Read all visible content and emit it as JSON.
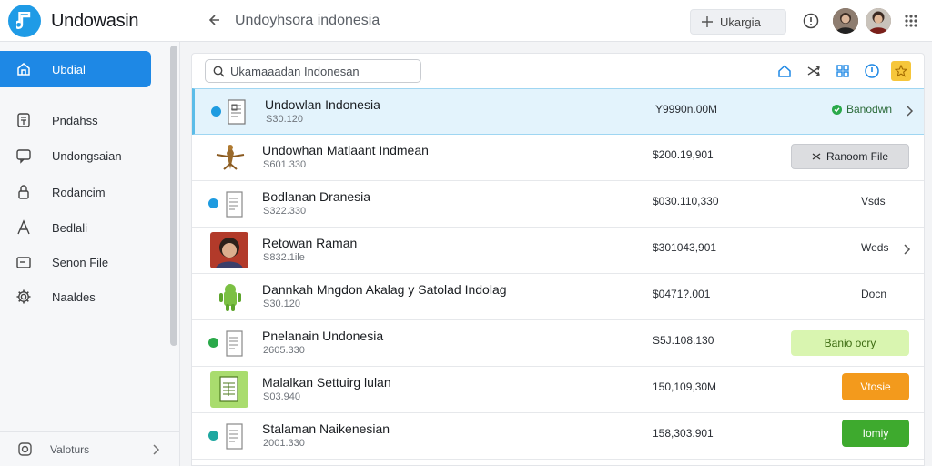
{
  "app": {
    "title": "Undowasin",
    "window_title": "Undoyhsora indonesia"
  },
  "header": {
    "search_chip_label": "Ukargia",
    "icons": [
      "info-icon",
      "avatar-1",
      "avatar-2",
      "more-grid-icon"
    ]
  },
  "sidebar": {
    "items": [
      {
        "label": "Ubdial",
        "icon": "home-icon",
        "active": true
      },
      {
        "label": "Pndahss",
        "icon": "document-icon",
        "active": false
      },
      {
        "label": "Undongsaian",
        "icon": "chat-icon",
        "active": false
      },
      {
        "label": "Rodancim",
        "icon": "lock-icon",
        "active": false
      },
      {
        "label": "Bedlali",
        "icon": "text-icon",
        "active": false
      },
      {
        "label": "Senon File",
        "icon": "folder-icon",
        "active": false
      },
      {
        "label": "Naaldes",
        "icon": "gear-icon",
        "active": false
      }
    ],
    "footer_label": "Valoturs"
  },
  "toolbar": {
    "search_placeholder": "Ukamaaadan Indonesan"
  },
  "rows": [
    {
      "name": "Undowlan Indonesia",
      "meta": "S30.120",
      "size": "Y9990n.00M",
      "status": "Banodwn",
      "selected": true
    },
    {
      "name": "Undowhan Matlaant  Indmean",
      "meta": "S601.330",
      "size": "$200.19,901",
      "action": "Ranoom File"
    },
    {
      "name": "Bodlanan Dranesia",
      "meta": "S322.330",
      "size": "$030.110,330",
      "status": "Vsds"
    },
    {
      "name": "Retowan Raman",
      "meta": "S832.1ile",
      "size": "$301043,901",
      "status": "Weds"
    },
    {
      "name": "Dannkah Mngdon Akalag y Satolad Indolag",
      "meta": "S30.120",
      "size": "$0471?.001",
      "status": "Docn"
    },
    {
      "name": "Pnelanain Undonesia",
      "meta": "2605.330",
      "size": "S5J.108.130",
      "action": "Banio ocry"
    },
    {
      "name": "Malalkan Settuirg lulan",
      "meta": "S03.940",
      "size": "150,109,30M",
      "action": "Vtosie"
    },
    {
      "name": "Stalaman Naikenesian",
      "meta": "2001.330",
      "size": "158,303.901",
      "action": "Iomiy"
    }
  ],
  "colors": {
    "accent": "#1e88e5",
    "selected_row": "#e3f3fc",
    "status_green": "#2aa94a",
    "pill_light_green": "#d9f5b0",
    "pill_orange": "#f39a1c",
    "pill_green": "#3eaa2e"
  }
}
